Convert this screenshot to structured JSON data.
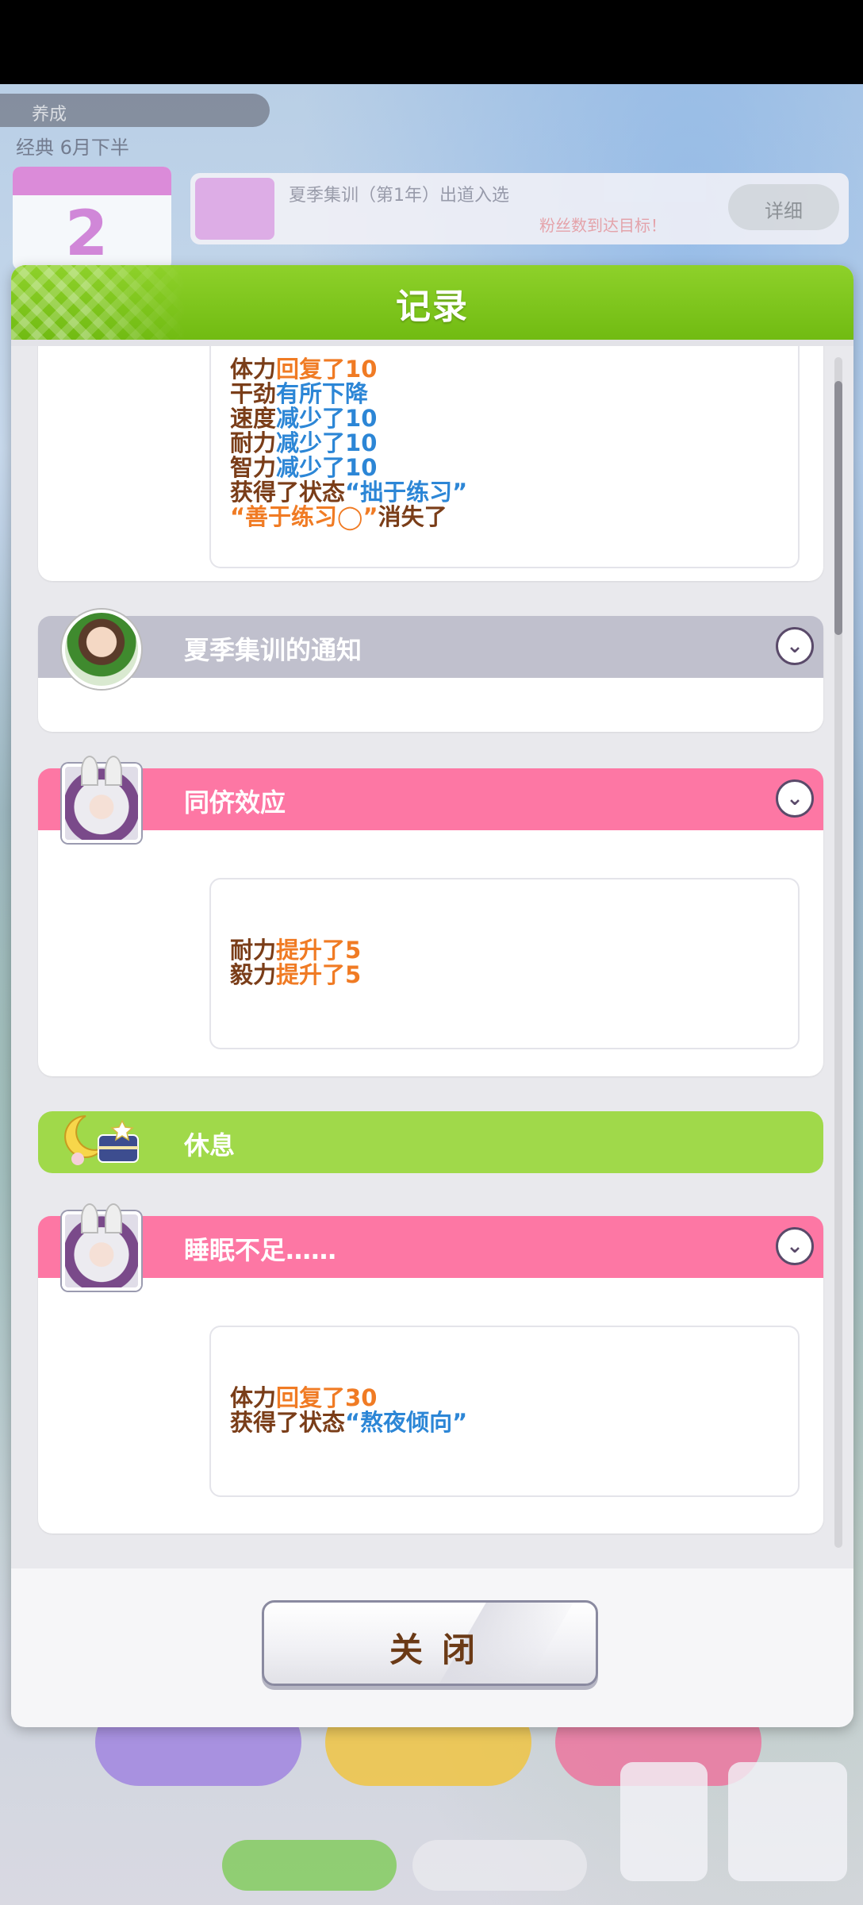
{
  "background": {
    "top_label": "养成",
    "date_text": "经典 6月下半",
    "turn_number": "2",
    "goal_text": "夏季集训（第1年）出道入选",
    "goal_subtext": "粉丝数到达目标！",
    "goal_button": "详细"
  },
  "modal": {
    "title": "记录",
    "close_label": "关闭"
  },
  "entries": [
    {
      "lines": [
        {
          "key": "体力",
          "value": "回复了10",
          "tone": "up"
        },
        {
          "key": "干劲",
          "value": "有所下降",
          "tone": "down"
        },
        {
          "key": "速度",
          "value": "减少了10",
          "tone": "down"
        },
        {
          "key": "耐力",
          "value": "减少了10",
          "tone": "down"
        },
        {
          "key": "智力",
          "value": "减少了10",
          "tone": "down"
        },
        {
          "key": "获得了状态",
          "value": "“拙于练习”",
          "tone": "down"
        },
        {
          "key": "",
          "value": "“善于练习◯”",
          "tone": "up",
          "suffix": "消失了"
        }
      ]
    },
    {
      "title": "夏季集训的通知",
      "style": "gray"
    },
    {
      "title": "同侪效应",
      "style": "pink",
      "lines": [
        {
          "key": "耐力",
          "value": "提升了5",
          "tone": "up"
        },
        {
          "key": "毅力",
          "value": "提升了5",
          "tone": "up"
        }
      ]
    },
    {
      "title": "休息",
      "style": "green"
    },
    {
      "title": "睡眠不足……",
      "style": "pink",
      "lines": [
        {
          "key": "体力",
          "value": "回复了30",
          "tone": "up"
        },
        {
          "key": "获得了状态",
          "value": "“熬夜倾向”",
          "tone": "down"
        }
      ]
    }
  ],
  "icons": {
    "expand": "chevron-down-icon",
    "trainer": "trainer-avatar-icon",
    "umamusume": "umamusume-avatar-icon",
    "rest": "rest-moon-icon"
  },
  "colors": {
    "header_green": "#71bb12",
    "pink_header": "#fd77a4",
    "gray_header": "#c0c0cd",
    "green_header": "#a0d94a",
    "increase": "#f07b24",
    "decrease": "#2c86d6",
    "label": "#7a3d18"
  }
}
